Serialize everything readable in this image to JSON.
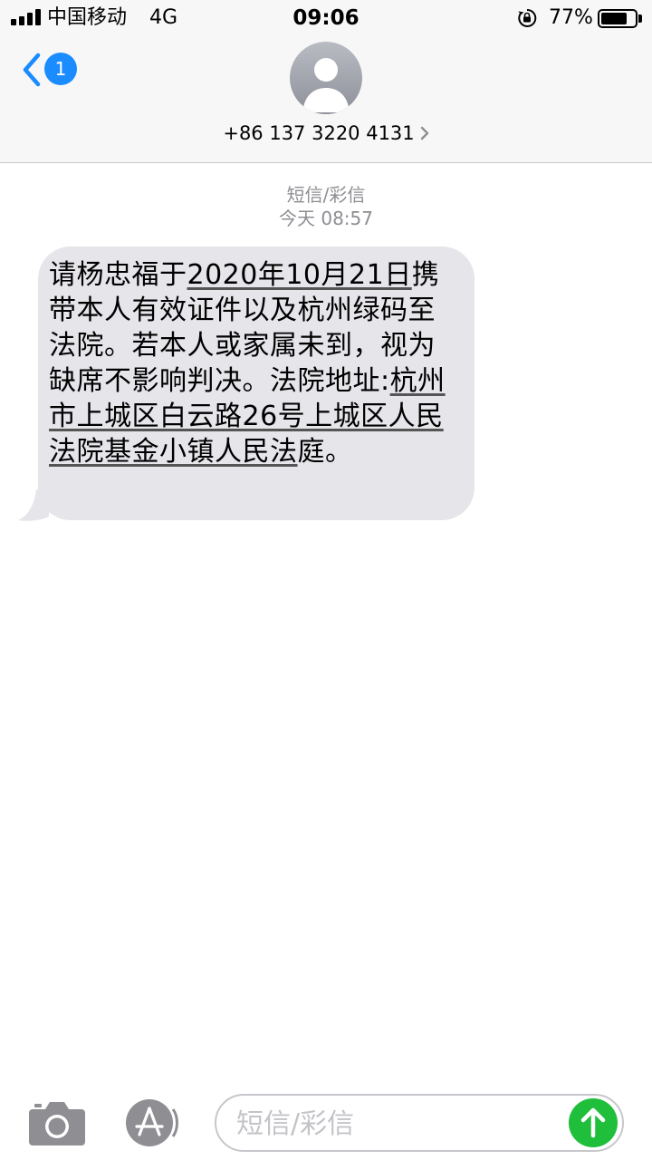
{
  "status_bar": {
    "carrier": "中国移动",
    "network": "4G",
    "time": "09:06",
    "battery_percent": "77%",
    "battery_level": 0.77
  },
  "header": {
    "back_badge": "1",
    "contact": "+86 137 3220 4131"
  },
  "conversation": {
    "message_type": "短信/彩信",
    "timestamp": "今天 08:57",
    "message": {
      "part1": "请杨忠福于",
      "date_link": "2020年10月21日",
      "part2": "携带本人有效证件以及杭州绿码至法院。若本人或家属未到，视为缺席不影响判决。法院地址:",
      "address_link": "杭州市上城区白云路26号上城区人民法院基金小镇人民法",
      "part3": "庭。"
    }
  },
  "input_bar": {
    "placeholder": "短信/彩信"
  },
  "colors": {
    "accent": "#1a8cff",
    "bubble": "#e5e5ea",
    "send": "#1fbe3b",
    "meta_text": "#8e8e93"
  },
  "icons": [
    "camera-icon",
    "appstore-icon",
    "send-arrow-icon",
    "back-chevron-icon",
    "lock-rotation-icon",
    "battery-icon",
    "signal-icon"
  ]
}
